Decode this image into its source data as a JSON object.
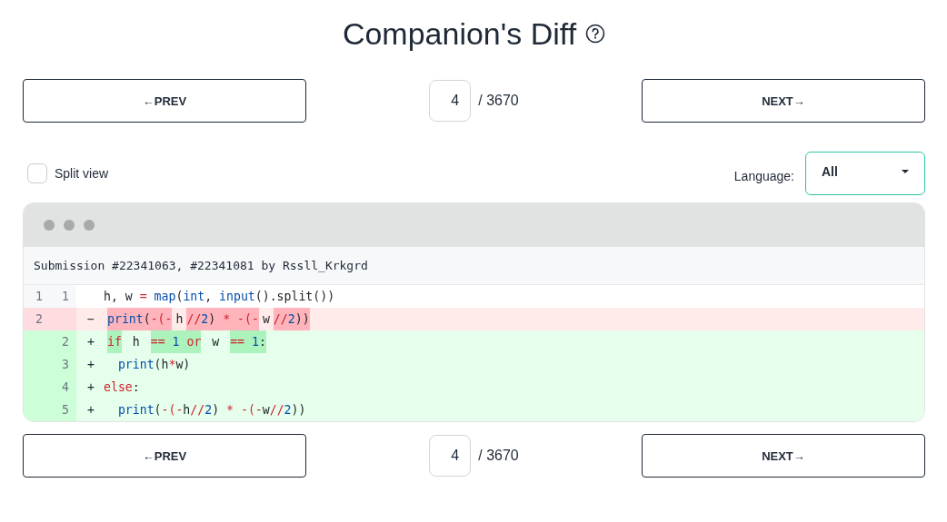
{
  "title": "Companion's Diff",
  "pager_top": {
    "prev": "←PREV",
    "page": "4",
    "total": "/ 3670",
    "next": "NEXT→"
  },
  "split_view": {
    "label": "Split view",
    "checked": false
  },
  "language": {
    "label": "Language:",
    "value": "All"
  },
  "diff": {
    "header": "Submission #22341063, #22341081 by Rssll_Krkgrd",
    "lines": [
      {
        "kind": "context",
        "old_no": "1",
        "new_no": "1",
        "tokens": [
          {
            "text": "h, w ",
            "kind": "plain",
            "changed": false
          },
          {
            "text": "= ",
            "kind": "op",
            "changed": false
          },
          {
            "text": "map",
            "kind": "builtin",
            "changed": false
          },
          {
            "text": "(",
            "kind": "plain",
            "changed": false
          },
          {
            "text": "int",
            "kind": "builtin",
            "changed": false
          },
          {
            "text": ", ",
            "kind": "plain",
            "changed": false
          },
          {
            "text": "input",
            "kind": "builtin",
            "changed": false
          },
          {
            "text": "().split())",
            "kind": "plain",
            "changed": false
          }
        ]
      },
      {
        "kind": "removed",
        "old_no": "2",
        "sign": "−",
        "tokens": [
          {
            "text": "print",
            "kind": "builtin",
            "changed": true
          },
          {
            "text": "(",
            "kind": "plain",
            "changed": true
          },
          {
            "text": "-(-",
            "kind": "op",
            "changed": true
          },
          {
            "text": "h",
            "kind": "plain",
            "changed": false
          },
          {
            "text": "//",
            "kind": "op",
            "changed": true
          },
          {
            "text": "2",
            "kind": "num",
            "changed": true
          },
          {
            "text": ") ",
            "kind": "plain",
            "changed": true
          },
          {
            "text": "* ",
            "kind": "op",
            "changed": true
          },
          {
            "text": "-(-",
            "kind": "op",
            "changed": true
          },
          {
            "text": "w",
            "kind": "plain",
            "changed": false
          },
          {
            "text": "//",
            "kind": "op",
            "changed": true
          },
          {
            "text": "2",
            "kind": "num",
            "changed": true
          },
          {
            "text": "))",
            "kind": "plain",
            "changed": true
          }
        ]
      },
      {
        "kind": "added",
        "new_no": "2",
        "sign": "+",
        "tokens": [
          {
            "text": "if",
            "kind": "keyword",
            "changed": true
          },
          {
            "text": " h ",
            "kind": "plain",
            "changed": false
          },
          {
            "text": "==",
            "kind": "op",
            "changed": true
          },
          {
            "text": " 1",
            "kind": "num",
            "changed": true
          },
          {
            "text": " or",
            "kind": "keyword",
            "changed": true
          },
          {
            "text": " w ",
            "kind": "plain",
            "changed": false
          },
          {
            "text": "==",
            "kind": "op",
            "changed": true
          },
          {
            "text": " 1",
            "kind": "num",
            "changed": true
          },
          {
            "text": ":",
            "kind": "plain",
            "changed": true
          }
        ]
      },
      {
        "kind": "added",
        "new_no": "3",
        "sign": "+",
        "tokens": [
          {
            "text": "  print",
            "kind": "builtin",
            "changed": false
          },
          {
            "text": "(h",
            "kind": "plain",
            "changed": false
          },
          {
            "text": "*",
            "kind": "op",
            "changed": false
          },
          {
            "text": "w)",
            "kind": "plain",
            "changed": false
          }
        ]
      },
      {
        "kind": "added",
        "new_no": "4",
        "sign": "+",
        "tokens": [
          {
            "text": "else",
            "kind": "keyword",
            "changed": false
          },
          {
            "text": ":",
            "kind": "plain",
            "changed": false
          }
        ]
      },
      {
        "kind": "added",
        "new_no": "5",
        "sign": "+",
        "tokens": [
          {
            "text": "  print",
            "kind": "builtin",
            "changed": false
          },
          {
            "text": "(",
            "kind": "plain",
            "changed": false
          },
          {
            "text": "-(-",
            "kind": "op",
            "changed": false
          },
          {
            "text": "h",
            "kind": "plain",
            "changed": false
          },
          {
            "text": "//",
            "kind": "op",
            "changed": false
          },
          {
            "text": "2",
            "kind": "num",
            "changed": false
          },
          {
            "text": ") ",
            "kind": "plain",
            "changed": false
          },
          {
            "text": "* ",
            "kind": "op",
            "changed": false
          },
          {
            "text": "-(-",
            "kind": "op",
            "changed": false
          },
          {
            "text": "w",
            "kind": "plain",
            "changed": false
          },
          {
            "text": "//",
            "kind": "op",
            "changed": false
          },
          {
            "text": "2",
            "kind": "num",
            "changed": false
          },
          {
            "text": "))",
            "kind": "plain",
            "changed": false
          }
        ]
      }
    ]
  },
  "pager_bottom": {
    "prev": "←PREV",
    "page": "4",
    "total": "/ 3670",
    "next": "NEXT→"
  }
}
